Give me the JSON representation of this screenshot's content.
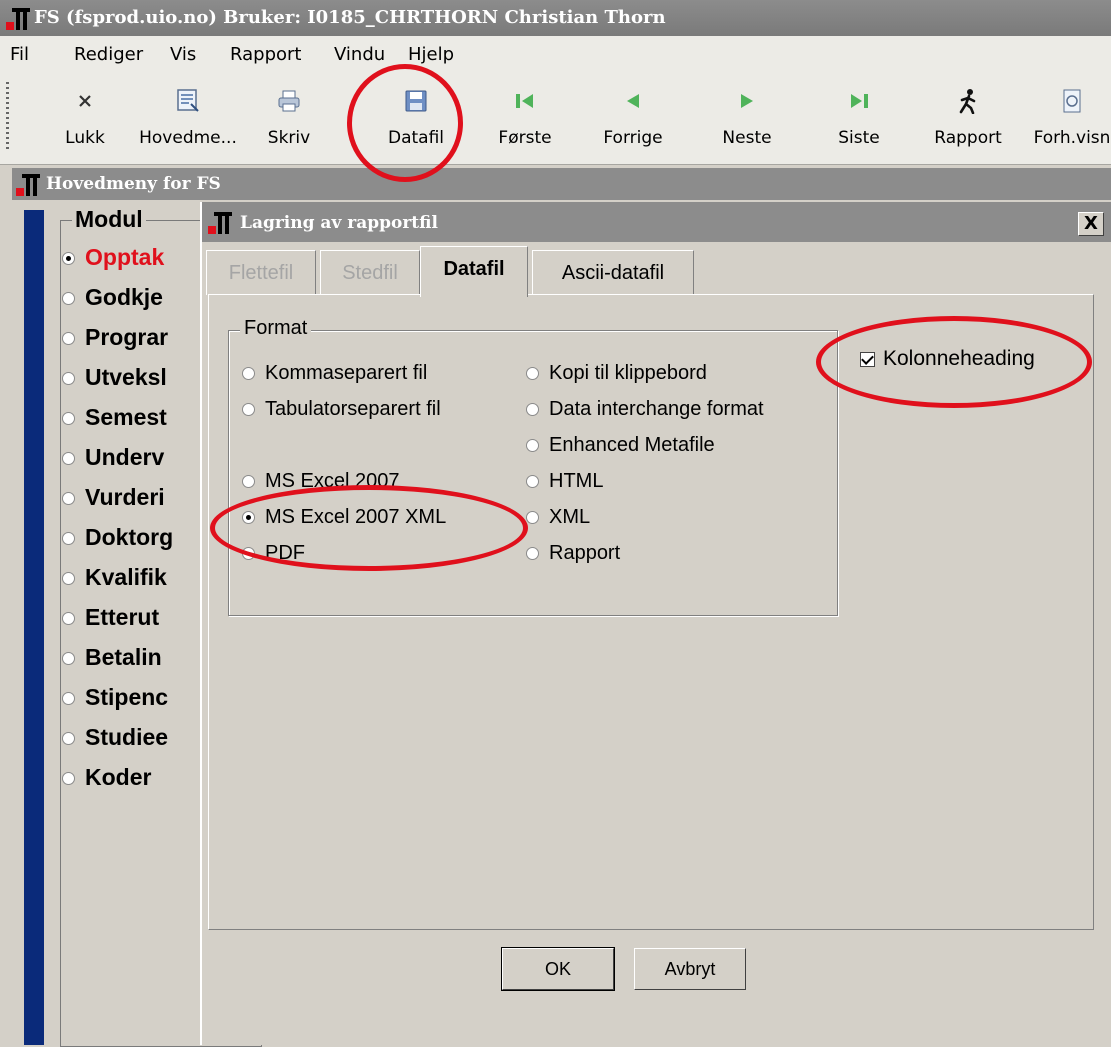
{
  "window": {
    "title": "FS (fsprod.uio.no) Bruker: I0185_CHRTHORN Christian Thorn"
  },
  "menu": [
    "Fil",
    "Rediger",
    "Vis",
    "Rapport",
    "Vindu",
    "Hjelp"
  ],
  "toolbar": {
    "buttons": [
      {
        "label": "Lukk",
        "icon": "close-icon"
      },
      {
        "label": "Hovedme...",
        "icon": "main-menu-icon"
      },
      {
        "label": "Skriv",
        "icon": "print-icon"
      },
      {
        "label": "Datafil",
        "icon": "floppy-disk-icon"
      },
      {
        "label": "Første",
        "icon": "first-record-icon"
      },
      {
        "label": "Forrige",
        "icon": "previous-record-icon"
      },
      {
        "label": "Neste",
        "icon": "next-record-icon"
      },
      {
        "label": "Siste",
        "icon": "last-record-icon"
      },
      {
        "label": "Rapport",
        "icon": "running-man-icon"
      },
      {
        "label": "Forh.visn",
        "icon": "preview-icon"
      }
    ]
  },
  "main_window": {
    "title": "Hovedmeny for FS",
    "modul_label": "Modul",
    "modules": [
      {
        "label": "Opptak",
        "selected": true
      },
      {
        "label": "Godkje",
        "selected": false
      },
      {
        "label": "Prograr",
        "selected": false
      },
      {
        "label": "Utveksl",
        "selected": false
      },
      {
        "label": "Semest",
        "selected": false
      },
      {
        "label": "Underv",
        "selected": false
      },
      {
        "label": "Vurderi",
        "selected": false
      },
      {
        "label": "Doktorg",
        "selected": false
      },
      {
        "label": "Kvalifik",
        "selected": false
      },
      {
        "label": "Etterut",
        "selected": false
      },
      {
        "label": "Betalin",
        "selected": false
      },
      {
        "label": "Stipenc",
        "selected": false
      },
      {
        "label": "Studiee",
        "selected": false
      },
      {
        "label": "Koder",
        "selected": false
      }
    ]
  },
  "dialog": {
    "title": "Lagring av rapportfil",
    "close_label": "X",
    "tabs": [
      {
        "label": "Flettefil",
        "state": "disabled"
      },
      {
        "label": "Stedfil",
        "state": "disabled"
      },
      {
        "label": "Datafil",
        "state": "active"
      },
      {
        "label": "Ascii-datafil",
        "state": "normal"
      }
    ],
    "format_label": "Format",
    "format_options_left": [
      {
        "label": "Kommaseparert fil",
        "selected": false
      },
      {
        "label": "Tabulatorseparert fil",
        "selected": false
      },
      {
        "label": "MS Excel 2007",
        "selected": false
      },
      {
        "label": "MS Excel 2007 XML",
        "selected": true
      },
      {
        "label": "PDF",
        "selected": false
      }
    ],
    "format_options_right": [
      {
        "label": "Kopi til klippebord",
        "selected": false
      },
      {
        "label": "Data interchange format",
        "selected": false
      },
      {
        "label": "Enhanced Metafile",
        "selected": false
      },
      {
        "label": "HTML",
        "selected": false
      },
      {
        "label": "XML",
        "selected": false
      },
      {
        "label": "Rapport",
        "selected": false
      }
    ],
    "column_heading": {
      "label": "Kolonneheading",
      "checked": true
    },
    "ok_label": "OK",
    "cancel_label": "Avbryt"
  },
  "colors": {
    "highlight": "#e0101c",
    "selected_module": "#e0101c",
    "side_bar": "#0a2a7a",
    "title_bar": "#8c8c8c"
  }
}
